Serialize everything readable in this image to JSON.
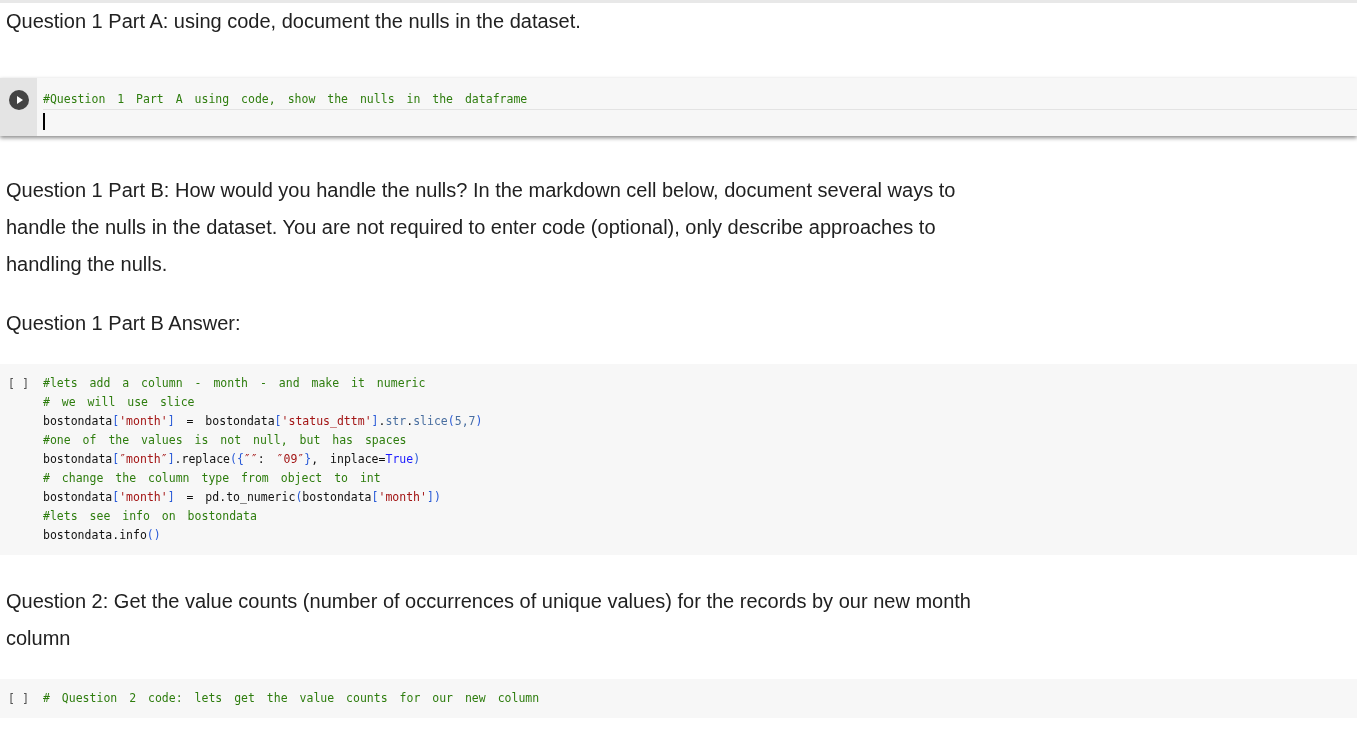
{
  "cells": [
    {
      "kind": "markdown",
      "text": "Question 1 Part A: using code, document the nulls in the dataset."
    },
    {
      "kind": "code",
      "active": true,
      "lines": [
        [
          {
            "kind": "comment",
            "text": "#Question 1 Part A using code, show the nulls in the dataframe"
          }
        ]
      ]
    },
    {
      "kind": "markdown",
      "text": "Question 1 Part B: How would you handle the nulls? In the markdown cell below, document several ways to handle the nulls in the dataset. You are not required to enter code (optional), only describe approaches to handling the nulls."
    },
    {
      "kind": "markdown",
      "text": "Question 1 Part B Answer:"
    },
    {
      "kind": "code",
      "active": false,
      "prompt": "[ ]",
      "lines": [
        [
          {
            "kind": "comment",
            "text": "#lets add a column - month - and make it numeric"
          }
        ],
        [
          {
            "kind": "comment",
            "text": "# we will use slice"
          }
        ],
        [
          {
            "kind": "plain",
            "text": "bostondata"
          },
          {
            "kind": "punct",
            "text": "["
          },
          {
            "kind": "string",
            "text": "'month'"
          },
          {
            "kind": "punct",
            "text": "]"
          },
          {
            "kind": "plain",
            "text": " = bostondata"
          },
          {
            "kind": "punct",
            "text": "["
          },
          {
            "kind": "string",
            "text": "'status_dttm'"
          },
          {
            "kind": "punct",
            "text": "]"
          },
          {
            "kind": "plain",
            "text": "."
          },
          {
            "kind": "method",
            "text": "str"
          },
          {
            "kind": "plain",
            "text": "."
          },
          {
            "kind": "method",
            "text": "slice"
          },
          {
            "kind": "punct",
            "text": "("
          },
          {
            "kind": "method",
            "text": "5,7"
          },
          {
            "kind": "punct",
            "text": ")"
          }
        ],
        [
          {
            "kind": "comment",
            "text": "#one of the values is not null, but has spaces"
          }
        ],
        [
          {
            "kind": "plain",
            "text": "bostondata"
          },
          {
            "kind": "punct",
            "text": "["
          },
          {
            "kind": "string",
            "text": "″month″"
          },
          {
            "kind": "punct",
            "text": "]"
          },
          {
            "kind": "plain",
            "text": ".replace"
          },
          {
            "kind": "punct",
            "text": "({"
          },
          {
            "kind": "string",
            "text": "″″"
          },
          {
            "kind": "plain",
            "text": ": "
          },
          {
            "kind": "string",
            "text": "″09″"
          },
          {
            "kind": "punct",
            "text": "}"
          },
          {
            "kind": "plain",
            "text": ", inplace="
          },
          {
            "kind": "keyword",
            "text": "True"
          },
          {
            "kind": "punct",
            "text": ")"
          }
        ],
        [
          {
            "kind": "comment",
            "text": "# change the column type from object to int"
          }
        ],
        [
          {
            "kind": "plain",
            "text": "bostondata"
          },
          {
            "kind": "punct",
            "text": "["
          },
          {
            "kind": "string",
            "text": "'month'"
          },
          {
            "kind": "punct",
            "text": "]"
          },
          {
            "kind": "plain",
            "text": " = pd.to_numeric"
          },
          {
            "kind": "punct",
            "text": "("
          },
          {
            "kind": "plain",
            "text": "bostondata"
          },
          {
            "kind": "punct",
            "text": "["
          },
          {
            "kind": "string",
            "text": "'month'"
          },
          {
            "kind": "punct",
            "text": "])"
          }
        ],
        [
          {
            "kind": "comment",
            "text": "#lets see info on bostondata"
          }
        ],
        [
          {
            "kind": "plain",
            "text": "bostondata.info"
          },
          {
            "kind": "punct",
            "text": "()"
          }
        ]
      ]
    },
    {
      "kind": "markdown",
      "text": "Question 2: Get the value counts (number of occurrences of unique values) for the records by our new month column"
    },
    {
      "kind": "code",
      "active": false,
      "prompt": "[ ]",
      "lines": [
        [
          {
            "kind": "comment",
            "text": "# Question 2 code: lets get the value counts for our new column"
          }
        ]
      ]
    }
  ]
}
